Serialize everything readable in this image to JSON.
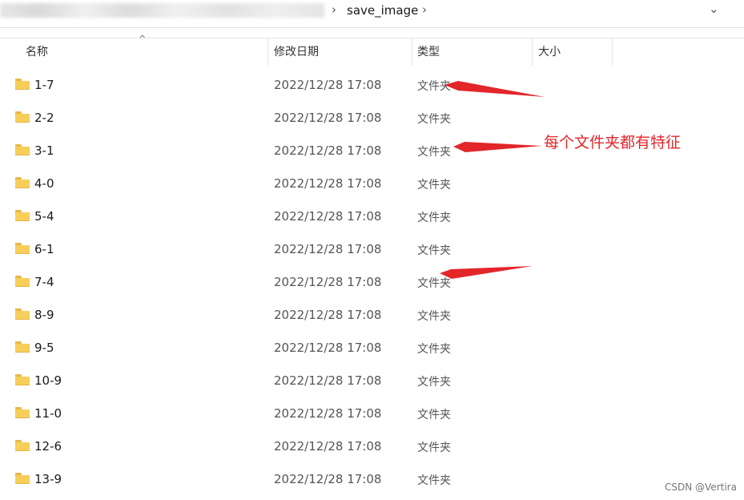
{
  "breadcrumb": {
    "current": "save_image"
  },
  "columns": {
    "name": "名称",
    "date": "修改日期",
    "type": "类型",
    "size": "大小"
  },
  "rows": [
    {
      "name": "1-7",
      "date": "2022/12/28 17:08",
      "type": "文件夹"
    },
    {
      "name": "2-2",
      "date": "2022/12/28 17:08",
      "type": "文件夹"
    },
    {
      "name": "3-1",
      "date": "2022/12/28 17:08",
      "type": "文件夹"
    },
    {
      "name": "4-0",
      "date": "2022/12/28 17:08",
      "type": "文件夹"
    },
    {
      "name": "5-4",
      "date": "2022/12/28 17:08",
      "type": "文件夹"
    },
    {
      "name": "6-1",
      "date": "2022/12/28 17:08",
      "type": "文件夹"
    },
    {
      "name": "7-4",
      "date": "2022/12/28 17:08",
      "type": "文件夹"
    },
    {
      "name": "8-9",
      "date": "2022/12/28 17:08",
      "type": "文件夹"
    },
    {
      "name": "9-5",
      "date": "2022/12/28 17:08",
      "type": "文件夹"
    },
    {
      "name": "10-9",
      "date": "2022/12/28 17:08",
      "type": "文件夹"
    },
    {
      "name": "11-0",
      "date": "2022/12/28 17:08",
      "type": "文件夹"
    },
    {
      "name": "12-6",
      "date": "2022/12/28 17:08",
      "type": "文件夹"
    },
    {
      "name": "13-9",
      "date": "2022/12/28 17:08",
      "type": "文件夹"
    }
  ],
  "annotation": {
    "text": "每个文件夹都有特征",
    "color": "#e3262a"
  },
  "watermark": "CSDN @Vertira",
  "icons": {
    "folder": "folder-icon",
    "chevron": "chevron-right-icon",
    "dropdown": "chevron-down-icon",
    "sort": "sort-ascending-icon"
  }
}
